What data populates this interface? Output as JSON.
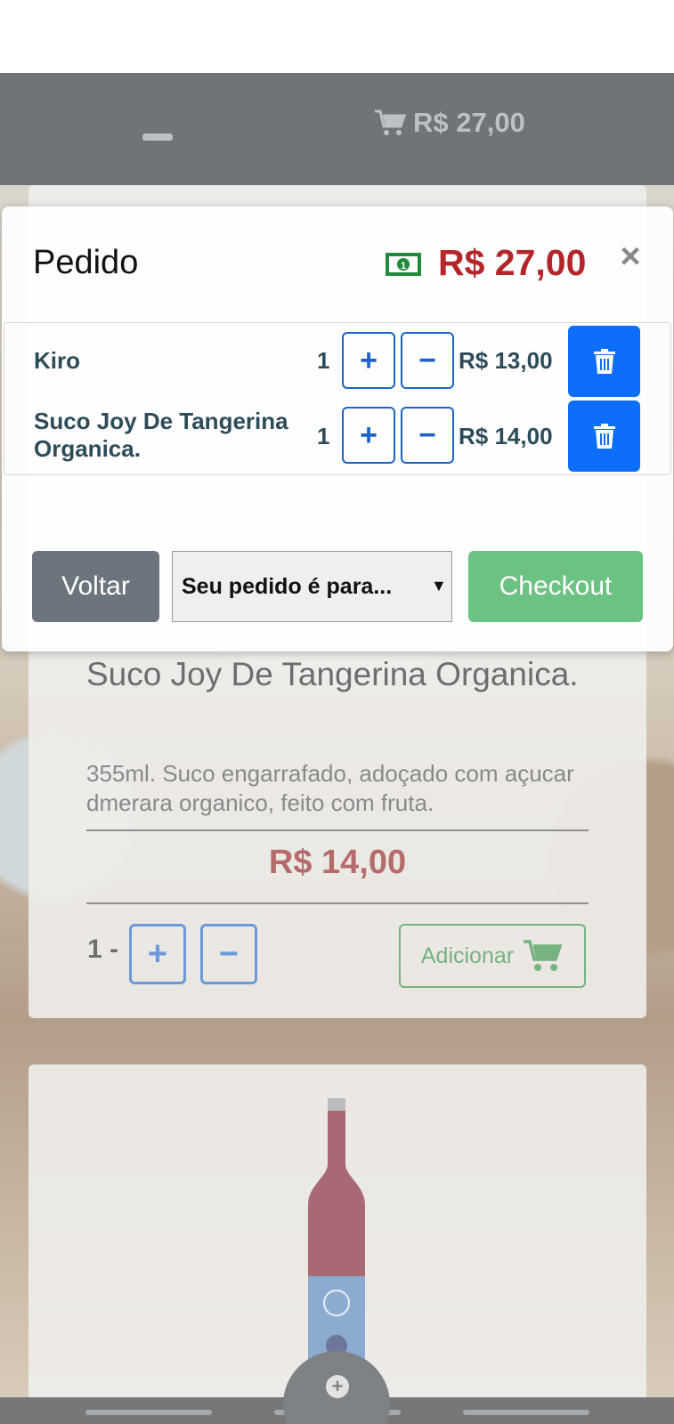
{
  "topbar": {
    "cart_total": "R$ 27,00"
  },
  "product": {
    "name": "Suco Joy De Tangerina Organica.",
    "description": "355ml. Suco engarrafado, adoçado com açucar dmerara organico, feito com fruta.",
    "price": "R$ 14,00",
    "quantity": "1",
    "quantity_separator": "-",
    "plus_label": "+",
    "minus_label": "−",
    "add_label": "Adicionar"
  },
  "next_product": {
    "fab_label": "+"
  },
  "modal": {
    "title": "Pedido",
    "total": "R$ 27,00",
    "close_label": "×",
    "items": [
      {
        "name": "Kiro",
        "quantity": "1",
        "price": "R$ 13,00"
      },
      {
        "name": "Suco Joy De Tangerina Organica.",
        "quantity": "1",
        "price": "R$ 14,00"
      }
    ],
    "plus_label": "+",
    "minus_label": "−",
    "back_label": "Voltar",
    "order_type_select": "Seu pedido é para...",
    "select_caret": "▼",
    "checkout_label": "Checkout"
  },
  "colors": {
    "primary_blue": "#0d6efd",
    "total_red": "#b5262b",
    "checkout_green": "#6cc283",
    "back_gray": "#6c757d",
    "add_green": "#2e8b3e"
  },
  "icons": [
    "cart-icon",
    "money-icon",
    "close-icon",
    "trash-icon",
    "plus-icon",
    "minus-icon",
    "hamburger-icon"
  ]
}
